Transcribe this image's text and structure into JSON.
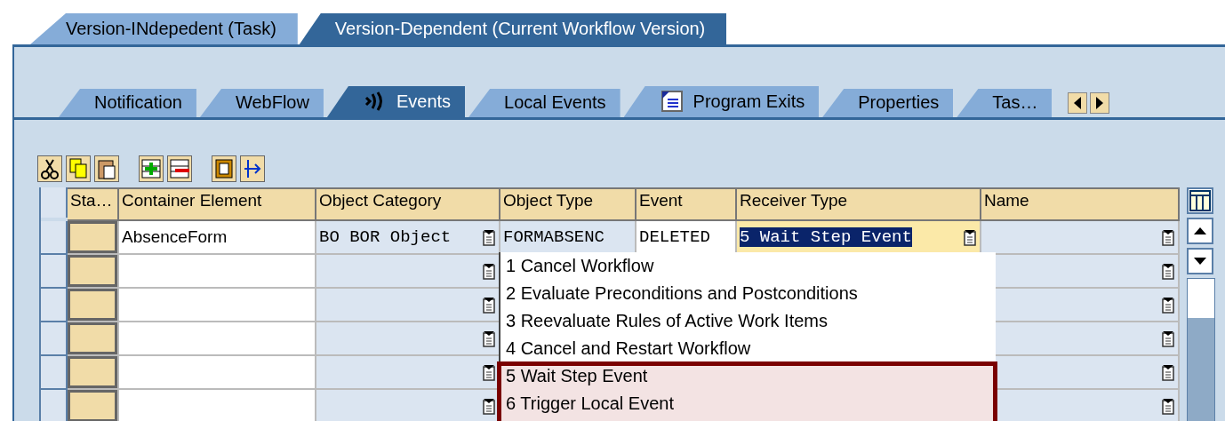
{
  "outer_tabs": [
    {
      "label": "Version-INdepedent (Task)",
      "selected": false
    },
    {
      "label": "Version-Dependent (Current Workflow Version)",
      "selected": true
    }
  ],
  "inner_tabs": [
    {
      "label": "Notification",
      "selected": false
    },
    {
      "label": "WebFlow",
      "selected": false
    },
    {
      "label": "Events",
      "selected": true
    },
    {
      "label": "Local Events",
      "selected": false
    },
    {
      "label": "Program Exits",
      "selected": false
    },
    {
      "label": "Properties",
      "selected": false
    },
    {
      "label": "Tas…",
      "selected": false
    }
  ],
  "table": {
    "columns": [
      "Sta…",
      "Container Element",
      "Object Category",
      "Object Type",
      "Event",
      "Receiver Type",
      "Name"
    ],
    "rows": [
      {
        "kind": "filled",
        "container_element": "AbsenceForm",
        "object_category": "BO BOR Object",
        "object_type": "FORMABSENC",
        "event": "DELETED",
        "receiver_type": "5 Wait Step Event"
      },
      {
        "kind": "empty"
      },
      {
        "kind": "empty"
      },
      {
        "kind": "empty"
      },
      {
        "kind": "empty"
      },
      {
        "kind": "empty"
      }
    ]
  },
  "dropdown": {
    "items": [
      {
        "label": "1  Cancel Workflow",
        "highlighted": false
      },
      {
        "label": "2  Evaluate Preconditions and Postconditions",
        "highlighted": false
      },
      {
        "label": "3  Reevaluate Rules of Active Work Items",
        "highlighted": false
      },
      {
        "label": "4  Cancel and Restart Workflow",
        "highlighted": false
      },
      {
        "label": "5  Wait Step Event",
        "highlighted": true
      },
      {
        "label": "6  Trigger Local Event",
        "highlighted": true
      }
    ]
  }
}
